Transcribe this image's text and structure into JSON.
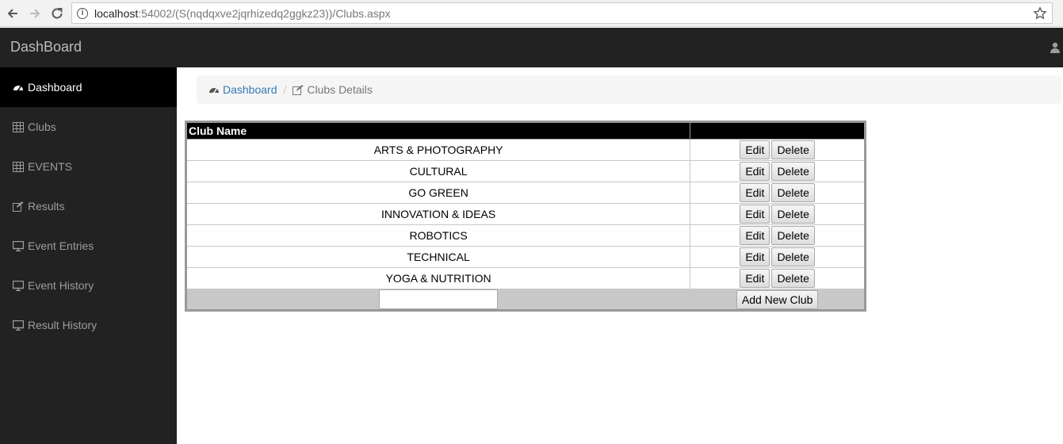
{
  "browser": {
    "url_host": "localhost",
    "url_rest": ":54002/(S(nqdqxve2jqrhizedq2ggkz23))/Clubs.aspx"
  },
  "navbar": {
    "brand": "DashBoard"
  },
  "sidebar": {
    "items": [
      {
        "label": "Dashboard",
        "icon": "dashboard-icon",
        "active": true
      },
      {
        "label": "Clubs",
        "icon": "table-icon"
      },
      {
        "label": "EVENTS",
        "icon": "table-icon"
      },
      {
        "label": "Results",
        "icon": "edit-icon"
      },
      {
        "label": "Event Entries",
        "icon": "desktop-icon"
      },
      {
        "label": "Event History",
        "icon": "desktop-icon"
      },
      {
        "label": "Result History",
        "icon": "desktop-icon"
      }
    ]
  },
  "breadcrumb": {
    "home": "Dashboard",
    "separator": "/",
    "current": "Clubs Details"
  },
  "table": {
    "header": "Club Name",
    "edit_label": "Edit",
    "delete_label": "Delete",
    "rows": [
      "ARTS & PHOTOGRAPHY",
      "CULTURAL",
      "GO GREEN",
      "INNOVATION & IDEAS",
      "ROBOTICS",
      "TECHNICAL",
      "YOGA & NUTRITION"
    ],
    "new_club_value": "",
    "add_button": "Add New Club"
  }
}
